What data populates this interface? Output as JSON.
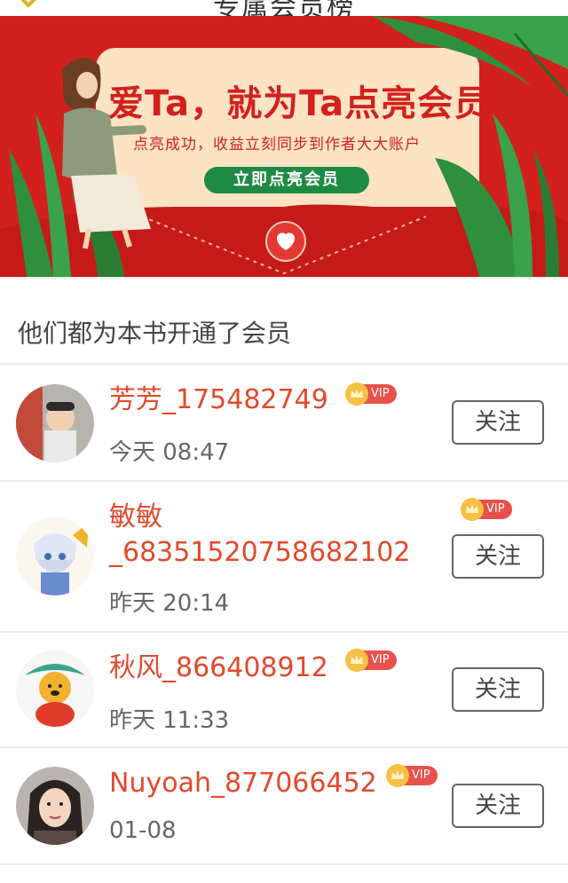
{
  "header": {
    "title": "专属会员榜"
  },
  "banner": {
    "headline": "爱Ta，就为Ta点亮会员",
    "subline": "点亮成功，收益立刻同步到作者大大账户",
    "cta": "立即点亮会员"
  },
  "section_title": "他们都为本书开通了会员",
  "members": [
    {
      "name": "芳芳_175482749",
      "time": "今天 08:47",
      "vip": "VIP",
      "follow": "关注"
    },
    {
      "name": "敏敏_68351520758682102",
      "time": "昨天 20:14",
      "vip": "VIP",
      "follow": "关注"
    },
    {
      "name": "秋风_866408912",
      "time": "昨天 11:33",
      "vip": "VIP",
      "follow": "关注"
    },
    {
      "name": "Nuyoah_877066452",
      "time": "01-08",
      "vip": "VIP",
      "follow": "关注"
    }
  ],
  "colors": {
    "brand_red": "#d2211d",
    "name_red": "#e2492c",
    "cta_green": "#1f8a43",
    "vip_badge": "#e8514b"
  }
}
